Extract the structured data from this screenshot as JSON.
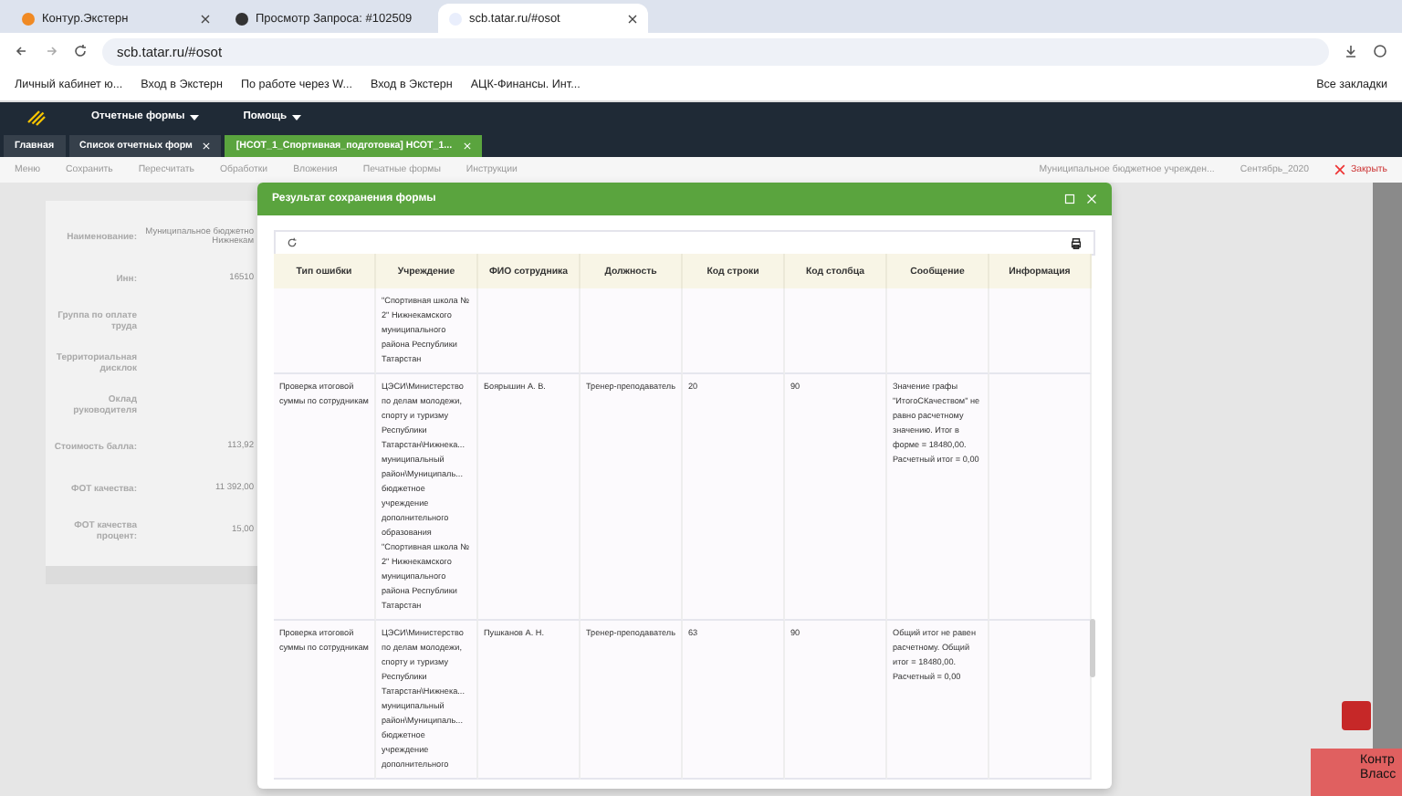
{
  "browser": {
    "tabs": [
      {
        "title": "Контур.Экстерн",
        "selected": false
      },
      {
        "title": "Просмотр Запроса: #102509",
        "selected": false
      },
      {
        "title": "scb.tatar.ru/#osot",
        "selected": true
      }
    ],
    "url": "scb.tatar.ru/#osot",
    "bookmarks": [
      "Личный кабинет ю...",
      "Вход в Экстерн",
      "По работе через W...",
      "Вход в Экстерн",
      "АЦК-Финансы. Инт..."
    ],
    "all_bookmarks": "Все закладки"
  },
  "app": {
    "menu": [
      "Отчетные формы",
      "Помощь"
    ],
    "tabs": [
      {
        "label": "Главная",
        "closable": false,
        "selected": false
      },
      {
        "label": "Список отчетных форм",
        "closable": true,
        "selected": false
      },
      {
        "label": "[НСОТ_1_Спортивная_подготовка] НСОТ_1...",
        "closable": true,
        "selected": true
      }
    ],
    "toolbar": [
      "Меню",
      "Сохранить",
      "Пересчитать",
      "Обработки",
      "Вложения",
      "Печатные формы",
      "Инструкции"
    ],
    "organization": "Муниципальное бюджетное учрежден...",
    "period": "Сентябрь_2020",
    "close": "Закрыть"
  },
  "form": {
    "fields": [
      {
        "label": "Наименование:",
        "value": "Муниципальное бюджетно",
        "value_2": "Нижнекам"
      },
      {
        "label": "Инн:",
        "value": "16510"
      },
      {
        "label": "Группа по оплате труда"
      },
      {
        "label": "Территориальная дисклок"
      },
      {
        "label": "Оклад руководителя"
      },
      {
        "label": "Стоимость балла:",
        "value": "113,92"
      },
      {
        "label": "ФОТ качества:",
        "value": "11 392,00"
      },
      {
        "label": "ФОТ качества процент:",
        "value": "15,00"
      }
    ]
  },
  "dialog": {
    "title": "Результат сохранения формы",
    "columns": [
      "Тип ошибки",
      "Учреждение",
      "ФИО сотрудника",
      "Должность",
      "Код строки",
      "Код столбца",
      "Сообщение",
      "Информация"
    ],
    "rows": [
      {
        "cells": [
          "",
          "\"Спортивная школа № 2\" Нижнекамского муниципального района Республики Татарстан",
          "",
          "",
          "",
          "",
          "",
          ""
        ]
      },
      {
        "cells": [
          "Проверка итоговой суммы по сотрудникам",
          "ЦЭСИ\\Министерство по делам молодежи, спорту и туризму Республики Татарстан\\Нижнека... муниципальный район\\Муниципаль... бюджетное учреждение дополнительного образования \"Спортивная школа № 2\" Нижнекамского муниципального района Республики Татарстан",
          "Боярышин А. В.",
          "Тренер-преподаватель",
          "20",
          "90",
          "Значение графы \"ИтогоСКачеством\" не равно расчетному значению. Итог в форме = 18480,00. Расчетный итог = 0,00",
          ""
        ]
      },
      {
        "cells": [
          "Проверка итоговой суммы по сотрудникам",
          "ЦЭСИ\\Министерство по делам молодежи, спорту и туризму Республики Татарстан\\Нижнека... муниципальный район\\Муниципаль... бюджетное учреждение дополнительного",
          "Пушканов А. Н.",
          "Тренер-преподаватель",
          "63",
          "90",
          "Общий итог не равен расчетному. Общий итог = 18480,00. Расчетный = 0,00",
          ""
        ]
      }
    ]
  },
  "notification": {
    "lines": [
      "Контр",
      "Власс"
    ]
  }
}
